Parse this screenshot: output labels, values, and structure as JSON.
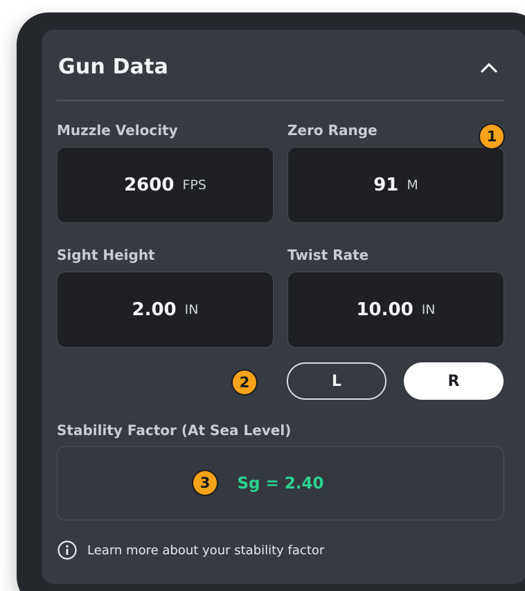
{
  "panel": {
    "title": "Gun Data",
    "collapse_icon": "chevron-up-icon"
  },
  "fields": {
    "muzzle_velocity": {
      "label": "Muzzle Velocity",
      "value": "2600",
      "unit": "FPS"
    },
    "zero_range": {
      "label": "Zero Range",
      "value": "91",
      "unit": "M"
    },
    "sight_height": {
      "label": "Sight Height",
      "value": "2.00",
      "unit": "IN"
    },
    "twist_rate": {
      "label": "Twist Rate",
      "value": "10.00",
      "unit": "IN"
    }
  },
  "twist_direction": {
    "left_label": "L",
    "right_label": "R",
    "selected": "R"
  },
  "stability": {
    "label": "Stability Factor (At Sea Level)",
    "value": "Sg = 2.40",
    "value_color": "#2bd28f"
  },
  "learn_more": {
    "icon": "info-icon",
    "text": "Learn more about your stability factor"
  },
  "markers": {
    "one": "1",
    "two": "2",
    "three": "3",
    "color": "#f5a31b"
  }
}
